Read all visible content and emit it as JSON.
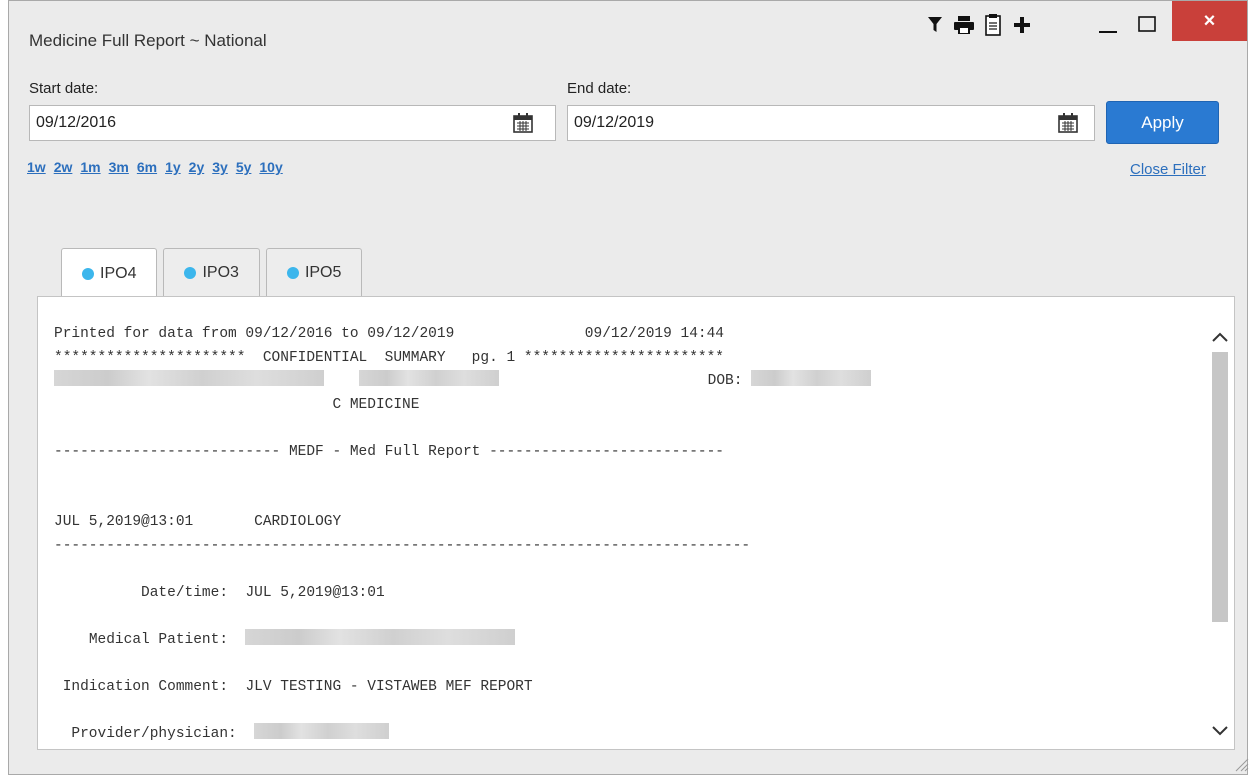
{
  "window": {
    "title": "Medicine Full Report ~ National"
  },
  "toolbar": {
    "icons": [
      "filter-icon",
      "print-icon",
      "clipboard-icon",
      "plus-icon"
    ],
    "minimize": "minimize-icon",
    "maximize": "maximize-icon",
    "close_label": "×"
  },
  "filter": {
    "start_label": "Start date:",
    "start_value": "09/12/2016",
    "end_label": "End date:",
    "end_value": "09/12/2019",
    "apply_label": "Apply",
    "ranges": [
      "1w",
      "2w",
      "1m",
      "3m",
      "6m",
      "1y",
      "2y",
      "3y",
      "5y",
      "10y"
    ],
    "close_filter_label": "Close Filter"
  },
  "tabs": [
    {
      "label": "IPO4",
      "active": true
    },
    {
      "label": "IPO3",
      "active": false
    },
    {
      "label": "IPO5",
      "active": false
    }
  ],
  "report": {
    "line1": "Printed for data from 09/12/2016 to 09/12/2019               09/12/2019 14:44",
    "line2": "**********************  CONFIDENTIAL  SUMMARY   pg. 1 ***********************",
    "line3_dob_label": "DOB:",
    "line4": "                                C MEDICINE",
    "line6": "-------------------------- MEDF - Med Full Report ---------------------------",
    "line9_date": "JUL 5,2019@13:01",
    "line9_dept": "CARDIOLOGY",
    "line10": "--------------------------------------------------------------------------------",
    "fields": [
      {
        "label": "Date/time:",
        "value": "JUL 5,2019@13:01"
      },
      {
        "label": "Medical Patient:",
        "value": ""
      },
      {
        "label": "Indication Comment:",
        "value": "JLV TESTING - VISTAWEB MEF REPORT"
      },
      {
        "label": "Provider/physician:",
        "value": ""
      }
    ]
  }
}
